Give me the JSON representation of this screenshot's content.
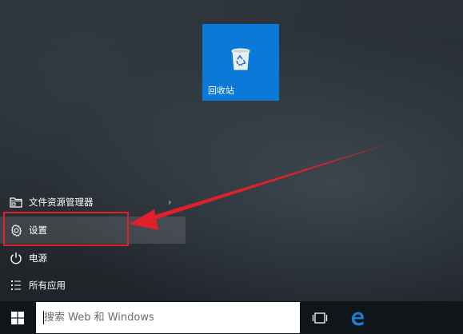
{
  "desktop": {
    "recycle_bin": {
      "label": "回收站",
      "tile_color": "#0a79d8",
      "icon": "recycle-bin-icon"
    }
  },
  "start_menu": {
    "items": [
      {
        "label": "文件资源管理器",
        "icon": "folder-explorer-icon",
        "has_submenu": true
      },
      {
        "label": "设置",
        "icon": "gear-icon",
        "highlighted": true
      },
      {
        "label": "电源",
        "icon": "power-icon"
      },
      {
        "label": "所有应用",
        "icon": "list-icon"
      }
    ],
    "submenu_glyph": "›"
  },
  "annotation": {
    "box_color": "#e0212b",
    "arrow_color": "#e0212b"
  },
  "taskbar": {
    "start_icon": "windows-logo-icon",
    "search": {
      "placeholder": "搜索 Web 和 Windows",
      "value": ""
    },
    "task_view_icon": "task-view-icon",
    "edge_icon": "edge-browser-icon",
    "edge_color": "#1c7dd6"
  }
}
